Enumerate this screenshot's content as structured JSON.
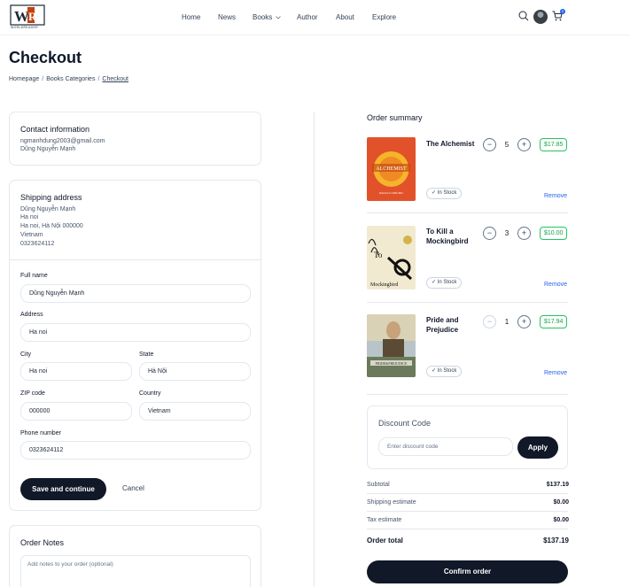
{
  "header": {
    "logo_text": "WORLDREADER",
    "nav": [
      "Home",
      "News",
      "Books",
      "Author",
      "About",
      "Explore"
    ],
    "cart_count": "0"
  },
  "page": {
    "title": "Checkout",
    "breadcrumb": [
      "Homepage",
      "Books Categories",
      "Checkout"
    ]
  },
  "contact": {
    "title": "Contact information",
    "email": "ngmanhdung2003@gmail.com",
    "name": "Dũng Nguyễn Mạnh"
  },
  "shipping": {
    "title": "Shipping address",
    "lines": [
      "Dũng Nguyễn Mạnh",
      "Ha noi",
      "Ha noi, Hà Nội 000000",
      "Vietnam",
      "0323624112"
    ],
    "labels": {
      "full_name": "Full name",
      "address": "Address",
      "city": "City",
      "state": "State",
      "zip": "ZIP code",
      "country": "Country",
      "phone": "Phone number"
    },
    "values": {
      "full_name": "Dũng Nguyễn Mạnh",
      "address": "Ha noi",
      "city": "Ha noi",
      "state": "Hà Nội",
      "zip": "000000",
      "country": "Vietnam",
      "phone": "0323624112"
    },
    "save_label": "Save and continue",
    "cancel_label": "Cancel"
  },
  "notes": {
    "title": "Order Notes",
    "placeholder": "Add notes to your order (optional)"
  },
  "summary": {
    "title": "Order summary",
    "items": [
      {
        "title": "The Alchemist",
        "qty": "5",
        "price": "$17.85",
        "stock": "In Stock",
        "remove": "Remove"
      },
      {
        "title": "To Kill a Mockingbird",
        "qty": "3",
        "price": "$10.00",
        "stock": "In Stock",
        "remove": "Remove"
      },
      {
        "title": "Pride and Prejudice",
        "qty": "1",
        "price": "$17.94",
        "stock": "In Stock",
        "remove": "Remove"
      }
    ],
    "discount": {
      "title": "Discount Code",
      "placeholder": "Enter discount code",
      "apply_label": "Apply"
    },
    "subtotal_label": "Subtotal",
    "subtotal": "$137.19",
    "shipping_label": "Shipping estimate",
    "shipping": "$0.00",
    "tax_label": "Tax estimate",
    "tax": "$0.00",
    "total_label": "Order total",
    "total": "$137.19",
    "confirm_label": "Confirm order"
  },
  "colors": {
    "primary_dark": "#111827",
    "price_green": "#16a34a",
    "link_blue": "#2563eb"
  }
}
